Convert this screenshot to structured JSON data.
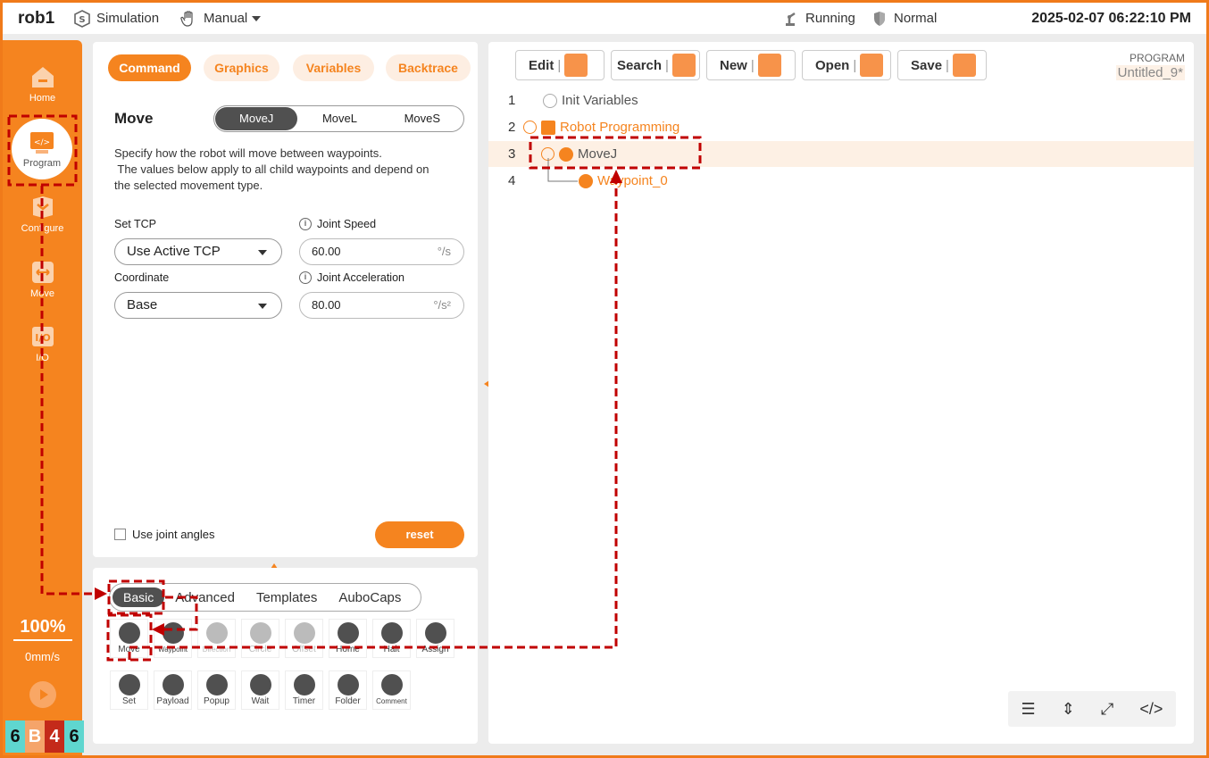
{
  "topbar": {
    "app_title": "rob1",
    "mode": "Simulation",
    "control": "Manual",
    "state": "Running",
    "safety": "Normal",
    "datetime": "2025-02-07 06:22:10 PM"
  },
  "rail": {
    "items": [
      {
        "label": "Home",
        "icon": "home-icon"
      },
      {
        "label": "Program",
        "icon": "code-icon"
      },
      {
        "label": "Configure",
        "icon": "configure-icon"
      },
      {
        "label": "Move",
        "icon": "move-icon"
      },
      {
        "label": "I/O",
        "icon": "io-icon"
      }
    ],
    "speed_percent": "100%",
    "tcp_speed": "0mm/s",
    "badges": [
      {
        "text": "6",
        "color": "#5fd6cf"
      },
      {
        "text": "B",
        "color": "#f5a46a"
      },
      {
        "text": "4",
        "color": "#c42a1a"
      },
      {
        "text": "6",
        "color": "#5fd6cf"
      }
    ]
  },
  "command_panel": {
    "tabs": [
      "Command",
      "Graphics",
      "Variables",
      "Backtrace"
    ],
    "title": "Move",
    "move_types": [
      "MoveJ",
      "MoveL",
      "MoveS"
    ],
    "description_line1": "Specify how the robot will move between waypoints.",
    "description_line2": " The values below apply to all child waypoints and depend on",
    "description_line3": "the selected movement type.",
    "set_tcp_label": "Set TCP",
    "set_tcp_value": "Use Active TCP",
    "coordinate_label": "Coordinate",
    "coordinate_value": "Base",
    "joint_speed_label": "Joint Speed",
    "joint_speed_value": "60.00",
    "joint_speed_unit": "°/s",
    "joint_accel_label": "Joint Acceleration",
    "joint_accel_value": "80.00",
    "joint_accel_unit": "°/s²",
    "use_joint_angles": "Use joint angles",
    "reset": "reset"
  },
  "toolbox": {
    "tabs": [
      "Basic",
      "Advanced",
      "Templates",
      "AuboCaps"
    ],
    "row1": [
      "Move",
      "Waypoint",
      "Direction",
      "Circle",
      "Offset",
      "Home",
      "Halt",
      "Assign"
    ],
    "row2": [
      "Set",
      "Payload",
      "Popup",
      "Wait",
      "Timer",
      "Folder",
      "Comment"
    ]
  },
  "program_panel": {
    "buttons": [
      "Edit",
      "Search",
      "New",
      "Open",
      "Save"
    ],
    "program_label": "PROGRAM",
    "program_name": "Untitled_9*",
    "lines": [
      {
        "num": "1",
        "text": "Init Variables"
      },
      {
        "num": "2",
        "text": "Robot Programming"
      },
      {
        "num": "3",
        "text": "MoveJ"
      },
      {
        "num": "4",
        "text": "Waypoint_0"
      }
    ]
  },
  "colors": {
    "accent": "#f5841f",
    "annotation": "#c00000"
  }
}
